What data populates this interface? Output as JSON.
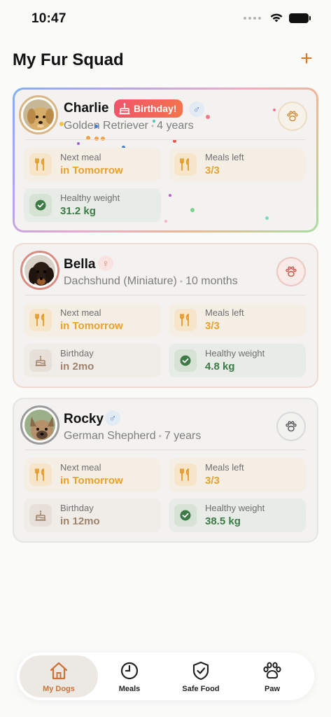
{
  "status_bar": {
    "time": "10:47"
  },
  "header": {
    "title": "My Fur Squad",
    "add_label": "+"
  },
  "dogs": [
    {
      "name": "Charlie",
      "gender_symbol": "♂",
      "birthday_badge": "Birthday!",
      "breed": "Golden Retriever",
      "age": "4 years",
      "next_meal_label": "Next meal",
      "next_meal_value": "in Tomorrow",
      "meals_left_label": "Meals left",
      "meals_left_value": "3/3",
      "weight_label": "Healthy weight",
      "weight_value": "31.2 kg"
    },
    {
      "name": "Bella",
      "gender_symbol": "♀",
      "breed": "Dachshund (Miniature)",
      "age": "10 months",
      "next_meal_label": "Next meal",
      "next_meal_value": "in Tomorrow",
      "meals_left_label": "Meals left",
      "meals_left_value": "3/3",
      "birthday_label": "Birthday",
      "birthday_value": "in 2mo",
      "weight_label": "Healthy weight",
      "weight_value": "4.8 kg"
    },
    {
      "name": "Rocky",
      "gender_symbol": "♂",
      "breed": "German Shepherd",
      "age": "7 years",
      "next_meal_label": "Next meal",
      "next_meal_value": "in Tomorrow",
      "meals_left_label": "Meals left",
      "meals_left_value": "3/3",
      "birthday_label": "Birthday",
      "birthday_value": "in 12mo",
      "weight_label": "Healthy weight",
      "weight_value": "38.5 kg"
    }
  ],
  "tab_bar": {
    "tabs": [
      {
        "label": "My Dogs",
        "icon": "house-icon",
        "active": true
      },
      {
        "label": "Meals",
        "icon": "clock-icon",
        "active": false
      },
      {
        "label": "Safe Food",
        "icon": "shield-check-icon",
        "active": false
      },
      {
        "label": "Paw",
        "icon": "paw-icon",
        "active": false
      }
    ]
  },
  "colors": {
    "accent": "#d27a2c",
    "meal_value": "#e8a22a",
    "weight_value": "#3c7a46",
    "birthday_value": "#a0836a",
    "birthday_badge": "#f0546a"
  }
}
